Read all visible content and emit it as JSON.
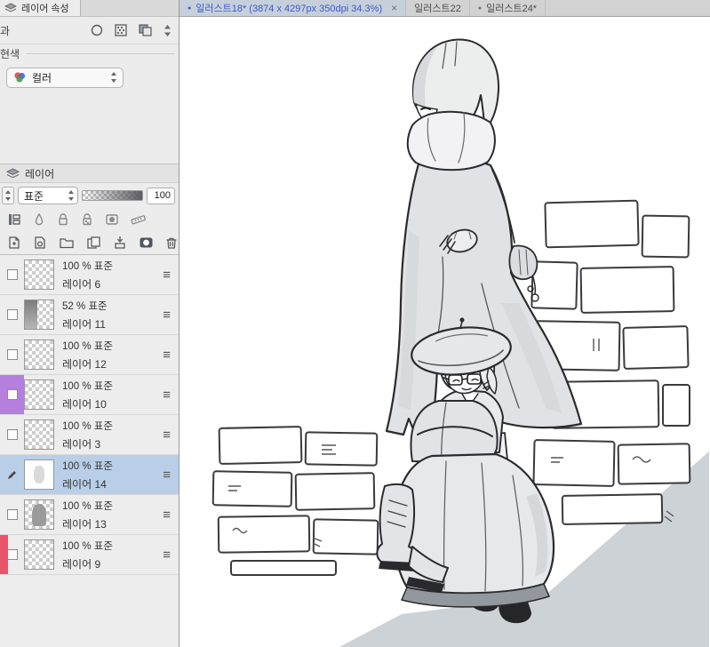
{
  "colors": {
    "selected_row": "#b9cfe8",
    "marker_purple": "#b57fdd",
    "marker_red": "#e8556a",
    "active_tab_text": "#3f58cc"
  },
  "icons": {
    "close": "×",
    "bullet": "●",
    "menu": "≡"
  },
  "left_panel": {
    "property_panel": {
      "title": "레이어 속성",
      "effect_partial_label": "과",
      "expression_partial_label": "현색",
      "color_mode": "컬러"
    },
    "layer_panel": {
      "title": "레이어",
      "blend_mode": "표준",
      "opacity": "100"
    },
    "layers": [
      {
        "info": "100 % 표준",
        "name": "레이어 6"
      },
      {
        "info": "52 % 표준",
        "name": "레이어 11"
      },
      {
        "info": "100 % 표준",
        "name": "레이어 12"
      },
      {
        "info": "100 % 표준",
        "name": "레이어 10",
        "marker": "purple"
      },
      {
        "info": "100 % 표준",
        "name": "레이어 3"
      },
      {
        "info": "100 % 표준",
        "name": "레이어 14",
        "selected": true,
        "editing": true
      },
      {
        "info": "100 % 표준",
        "name": "레이어 13"
      },
      {
        "info": "100 % 표준",
        "name": "레이어 9",
        "marker": "red"
      }
    ]
  },
  "tab_bar": {
    "tabs": [
      {
        "label": "일러스트18* (3874 x 4297px 350dpi 34.3%)",
        "active": true,
        "modified": true
      },
      {
        "label": "일러스트22",
        "active": false,
        "modified": false
      },
      {
        "label": "일러스트24*",
        "active": false,
        "modified": true
      }
    ]
  }
}
